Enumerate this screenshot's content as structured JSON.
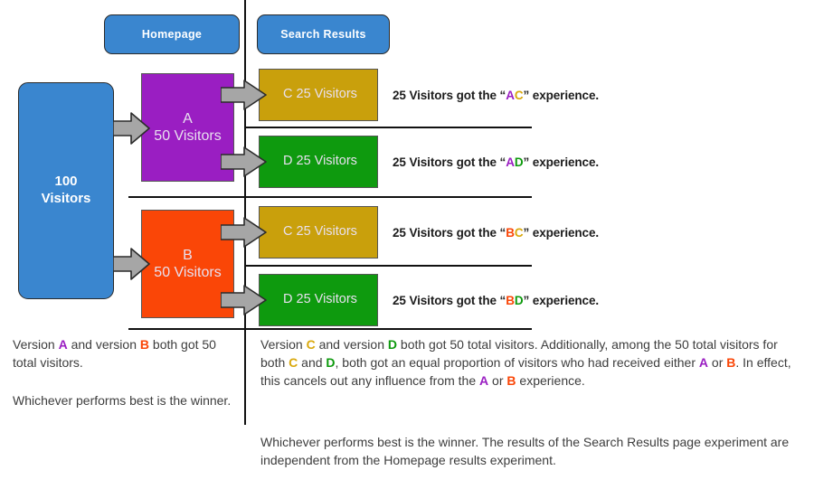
{
  "colors": {
    "blue": "#3A86CF",
    "purple": "#9A1EC2",
    "orange": "#FA4607",
    "gold": "#C9A00C",
    "green": "#0E9A0E",
    "arrow_gray": "#A6A6A6",
    "line_black": "#111111"
  },
  "headers": {
    "homepage": "Homepage",
    "search_results": "Search Results"
  },
  "source": {
    "count": "100",
    "unit": "Visitors"
  },
  "homepage_variants": [
    {
      "letter": "A",
      "detail": "50 Visitors",
      "color": "#9A1EC2"
    },
    {
      "letter": "B",
      "detail": "50 Visitors",
      "color": "#FA4607"
    }
  ],
  "search_variants": [
    {
      "label": "C 25 Visitors",
      "color": "#C9A00C"
    },
    {
      "label": "D 25 Visitors",
      "color": "#0E9A0E"
    },
    {
      "label": "C 25 Visitors",
      "color": "#C9A00C"
    },
    {
      "label": "D 25 Visitors",
      "color": "#0E9A0E"
    }
  ],
  "captions": [
    {
      "prefix": "25 Visitors got the “",
      "first": "A",
      "second": "C",
      "suffix": "” experience."
    },
    {
      "prefix": "25 Visitors got the “",
      "first": "A",
      "second": "D",
      "suffix": "” experience."
    },
    {
      "prefix": "25 Visitors got the “",
      "first": "B",
      "second": "C",
      "suffix": "” experience."
    },
    {
      "prefix": "25 Visitors got the “",
      "first": "B",
      "second": "D",
      "suffix": "” experience."
    }
  ],
  "notes": {
    "left_p1_a": "Version ",
    "left_p1_A": "A",
    "left_p1_b": " and version ",
    "left_p1_B": "B",
    "left_p1_c": " both got 50 total visitors.",
    "left_p2": "Whichever performs best is the winner.",
    "right_p1_s1": "Version ",
    "right_p1_C1": "C",
    "right_p1_s2": " and version ",
    "right_p1_D1": "D",
    "right_p1_s3": " both got 50 total visitors.  Additionally, among the 50 total visitors for both ",
    "right_p1_C2": "C",
    "right_p1_s4": " and ",
    "right_p1_D2": "D",
    "right_p1_s5": ", both got an equal proportion of visitors who had received either ",
    "right_p1_A1": "A",
    "right_p1_s6": " or ",
    "right_p1_B1": "B",
    "right_p1_s7": ". In effect, this cancels out any influence from the ",
    "right_p1_A2": "A",
    "right_p1_s8": " or ",
    "right_p1_B2": "B",
    "right_p1_s9": " experience.",
    "right_p2": "Whichever performs best is the winner. The results of the Search Results page experiment are independent from the Homepage results experiment."
  }
}
